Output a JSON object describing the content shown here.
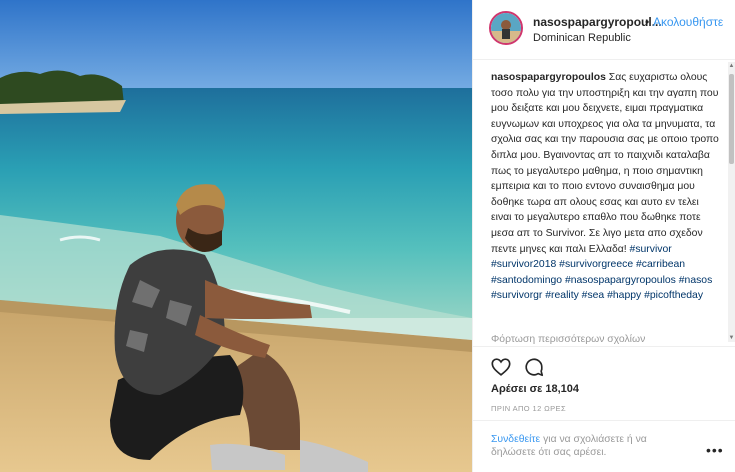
{
  "post": {
    "username": "nasospapargyropoul...",
    "dot": "•",
    "follow_label": "Ακολουθήστε",
    "location": "Dominican Republic"
  },
  "caption": {
    "username": "nasospapargyropoulos",
    "text": "Σας ευχαριστω ολους τοσο πολυ για την υποστηριξη και την αγαπη που μου δειξατε και μου δειχνετε, ειμαι πραγματικα ευγνωμων και υποχρεος για ολα τα μηνυματα, τα σχολια σας και την παρουσια σας με οποιο τροπο διπλα μου. Βγαινοντας απ το παιχνιδι καταλαβα πως το μεγαλυτερο μαθημα, η ποιο σημαντικη εμπειρια και το ποιο εντονο συναισθημα μου δοθηκε τωρα απ ολους εσας και αυτο εν τελει ειναι το μεγαλυτερο επαθλο που δωθηκε ποτε μεσα απ το Survivor. Σε λιγο μετα απο σχεδον πεντε μηνες και παλι Ελλαδα!",
    "hashtags": [
      "#survivor",
      "#survivor2018",
      "#survivorgreece",
      "#carribean",
      "#santodomingo",
      "#nasospapargyropoulos",
      "#nasos",
      "#survivorgr",
      "#reality",
      "#sea",
      "#happy",
      "#picoftheday"
    ]
  },
  "more_comments": "Φόρτωση περισσότερων σχολίων",
  "icons": {
    "like": "heart-icon",
    "comment": "comment-icon",
    "options": "more-options-icon"
  },
  "likes_text": "Αρέσει σε 18,104",
  "timestamp": "ΠΡΙΝ ΑΠΟ 12 ΩΡΕΣ",
  "comment_prompt": {
    "link": "Συνδεθείτε",
    "text": " για να σχολιάσετε ή να δηλώσετε ότι σας αρέσει."
  },
  "colors": {
    "link": "#3897f0",
    "hashtag": "#003569",
    "muted": "#999999",
    "text": "#262626"
  }
}
